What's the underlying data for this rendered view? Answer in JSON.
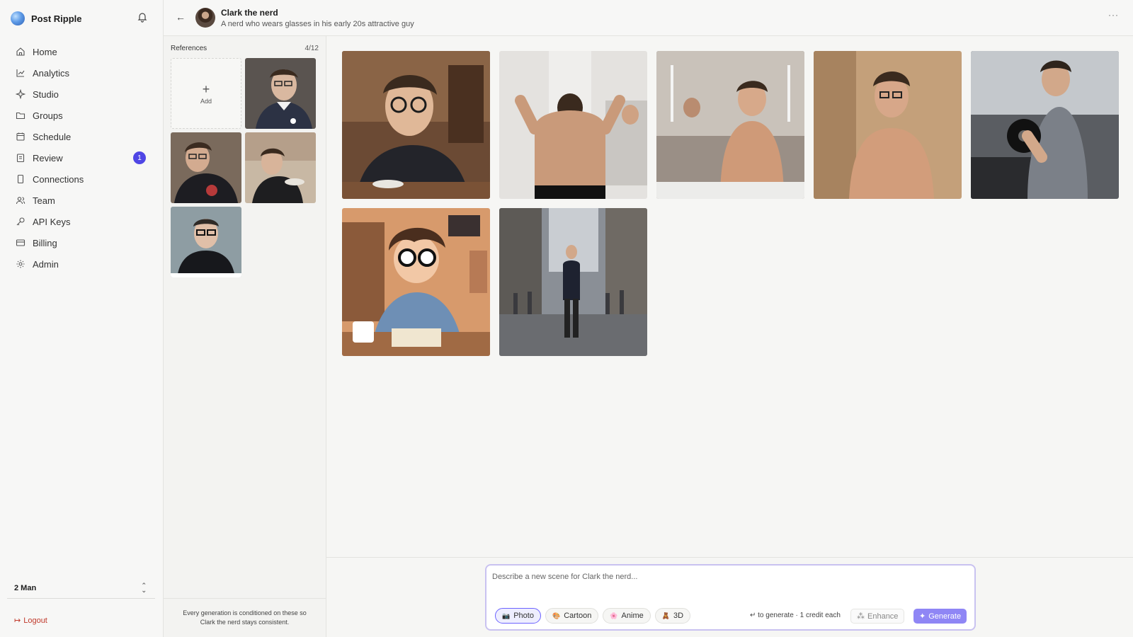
{
  "app": {
    "name": "Post Ripple"
  },
  "sidebar": {
    "items": [
      {
        "label": "Home",
        "icon": "home-icon"
      },
      {
        "label": "Analytics",
        "icon": "analytics-icon"
      },
      {
        "label": "Studio",
        "icon": "sparkle-icon"
      },
      {
        "label": "Groups",
        "icon": "folder-icon"
      },
      {
        "label": "Schedule",
        "icon": "calendar-icon"
      },
      {
        "label": "Review",
        "icon": "clipboard-icon",
        "badge": "1"
      },
      {
        "label": "Connections",
        "icon": "device-icon"
      },
      {
        "label": "Team",
        "icon": "users-icon"
      },
      {
        "label": "API Keys",
        "icon": "key-icon"
      },
      {
        "label": "Billing",
        "icon": "card-icon"
      },
      {
        "label": "Admin",
        "icon": "gear-icon"
      }
    ],
    "workspace": "2 Man",
    "logout": "Logout"
  },
  "header": {
    "name": "Clark the nerd",
    "description": "A nerd who wears glasses in his early 20s attractive guy"
  },
  "references": {
    "title": "References",
    "count": "4/12",
    "add_label": "Add",
    "note": "Every generation is conditioned on these so Clark the nerd stays consistent."
  },
  "composer": {
    "placeholder": "Describe a new scene for Clark the nerd...",
    "styles": [
      {
        "label": "Photo",
        "icon": "camera-icon",
        "active": true
      },
      {
        "label": "Cartoon",
        "icon": "palette-icon",
        "active": false
      },
      {
        "label": "Anime",
        "icon": "flower-icon",
        "active": false
      },
      {
        "label": "3D",
        "icon": "figure-icon",
        "active": false
      }
    ],
    "hint": "↵ to generate · 1 credit each",
    "enhance": "Enhance",
    "generate": "Generate"
  },
  "colors": {
    "accent": "#4f46e5",
    "generate_bg": "#8f86f5",
    "logout": "#c0392b"
  }
}
